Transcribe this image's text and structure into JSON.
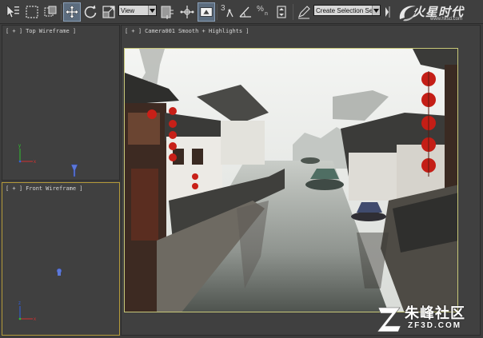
{
  "toolbar": {
    "reference_coordinate_dropdown": "View",
    "selection_set_dropdown": "Create Selection Se",
    "snap_toggle_label": "3",
    "spinner_snap_label": "%",
    "spinner_snap_sublabel": "n"
  },
  "viewports": {
    "top": {
      "bracket": "[ + ]",
      "view": "Top",
      "shading": "Wireframe ]"
    },
    "front": {
      "bracket": "[ + ]",
      "view": "Front",
      "shading": "Wireframe ]"
    },
    "camera": {
      "bracket": "[ + ]",
      "view": "Camera001",
      "shading": "Smooth + Highlights ]"
    }
  },
  "gizmo_axes": {
    "x": "x",
    "y": "y",
    "z": "z"
  },
  "logo": {
    "text": "火星时代",
    "url": "www.hxsd.com"
  },
  "watermark": {
    "chinese": "朱峰社区",
    "english": "ZF3D.COM"
  },
  "colors": {
    "background": "#3c3c3c",
    "viewport_active_border": "#b59b3a",
    "render_frame_border": "#c8c878",
    "axis_x": "#d03030",
    "axis_y": "#30c030",
    "axis_z": "#3060e0"
  }
}
